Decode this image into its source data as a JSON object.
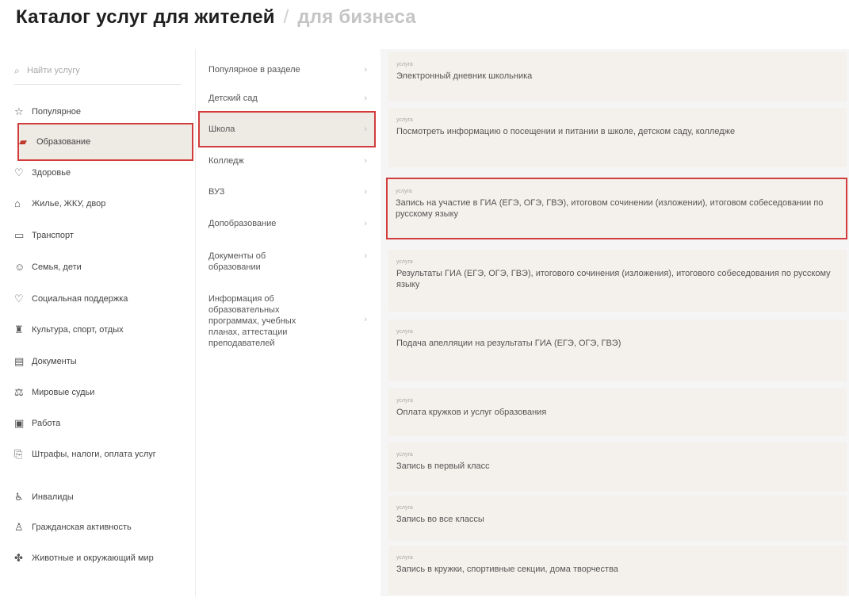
{
  "header": {
    "title": "Каталог услуг для жителей",
    "separator": "/",
    "business_link": "для бизнеса"
  },
  "search": {
    "placeholder": "Найти услугу"
  },
  "categories": [
    {
      "label": "Популярное",
      "icon": "star-icon"
    },
    {
      "label": "Образование",
      "icon": "book-icon"
    },
    {
      "label": "Здоровье",
      "icon": "heart-icon"
    },
    {
      "label": "Жилье, ЖКУ, двор",
      "icon": "house-icon"
    },
    {
      "label": "Транспорт",
      "icon": "bus-icon"
    },
    {
      "label": "Семья, дети",
      "icon": "family-icon"
    },
    {
      "label": "Социальная поддержка",
      "icon": "hand-icon"
    },
    {
      "label": "Культура, спорт, отдых",
      "icon": "theater-icon"
    },
    {
      "label": "Документы",
      "icon": "document-icon"
    },
    {
      "label": "Мировые судьи",
      "icon": "gavel-icon"
    },
    {
      "label": "Работа",
      "icon": "briefcase-icon"
    },
    {
      "label": "Штрафы, налоги, оплата услуг",
      "icon": "receipt-icon"
    },
    {
      "label": "Инвалиды",
      "icon": "accessibility-icon"
    },
    {
      "label": "Гражданская активность",
      "icon": "citizen-icon"
    },
    {
      "label": "Животные и окружающий мир",
      "icon": "paw-icon"
    }
  ],
  "subcategories": [
    {
      "label": "Популярное в разделе"
    },
    {
      "label": "Детский сад"
    },
    {
      "label": "Школа"
    },
    {
      "label": "Колледж"
    },
    {
      "label": "ВУЗ"
    },
    {
      "label": "Допобразование"
    },
    {
      "label": "Документы об образовании"
    },
    {
      "label": "Информация об образовательных программах, учебных планах, аттестации преподавателей"
    }
  ],
  "services": [
    {
      "tag": "услуга",
      "title": "Электронный дневник школьника"
    },
    {
      "tag": "услуга",
      "title": "Посмотреть информацию о посещении и питании в школе, детском саду, колледже"
    },
    {
      "tag": "услуга",
      "title": "Запись на участие в ГИА (ЕГЭ, ОГЭ, ГВЭ), итоговом сочинении (изложении), итоговом собеседовании по русскому языку"
    },
    {
      "tag": "услуга",
      "title": "Результаты ГИА (ЕГЭ, ОГЭ, ГВЭ), итогового сочинения (изложения), итогового собеседования по русскому языку"
    },
    {
      "tag": "услуга",
      "title": "Подача апелляции на результаты ГИА (ЕГЭ, ОГЭ, ГВЭ)"
    },
    {
      "tag": "услуга",
      "title": "Оплата кружков и услуг образования"
    },
    {
      "tag": "услуга",
      "title": "Запись в первый класс"
    },
    {
      "tag": "услуга",
      "title": "Запись во все классы"
    },
    {
      "tag": "услуга",
      "title": "Запись в кружки, спортивные секции, дома творчества"
    }
  ],
  "colors": {
    "highlight_border": "#d33c3c",
    "active_bg": "#eeeae4",
    "card_bg": "#f4f1ec"
  }
}
